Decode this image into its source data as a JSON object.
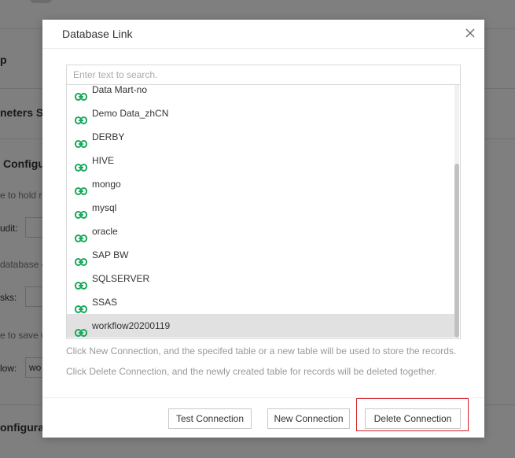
{
  "background": {
    "section_p": "p",
    "parameters": "neters Se",
    "config": "Configu",
    "hold_text": "e to hold re",
    "audit_label": "udit:",
    "database_text": "database c",
    "tasks_label": "sks:",
    "save_text": "e to save w",
    "flow_label": "low:",
    "flow_value": "wo",
    "configuration": "onfigurat"
  },
  "modal": {
    "title": "Database Link",
    "close_icon": "close-icon",
    "search_placeholder": "Enter text to search.",
    "items": [
      {
        "label": "Data Mart-no"
      },
      {
        "label": "Demo Data_zhCN"
      },
      {
        "label": "DERBY"
      },
      {
        "label": "HIVE"
      },
      {
        "label": "mongo"
      },
      {
        "label": "mysql"
      },
      {
        "label": "oracle"
      },
      {
        "label": "SAP BW"
      },
      {
        "label": "SQLSERVER"
      },
      {
        "label": "SSAS"
      },
      {
        "label": "workflow20200119",
        "selected": true
      }
    ],
    "item_icon": "link-icon",
    "icon_color": "#1aa85c",
    "hint_new": "Click New Connection, and the specifed table or a new table will be used to store the records.",
    "hint_delete": "Click Delete Connection, and the newly created table for records will be deleted together.",
    "buttons": {
      "test": "Test Connection",
      "new": "New Connection",
      "delete": "Delete Connection"
    },
    "highlight_color": "#d6222a"
  }
}
